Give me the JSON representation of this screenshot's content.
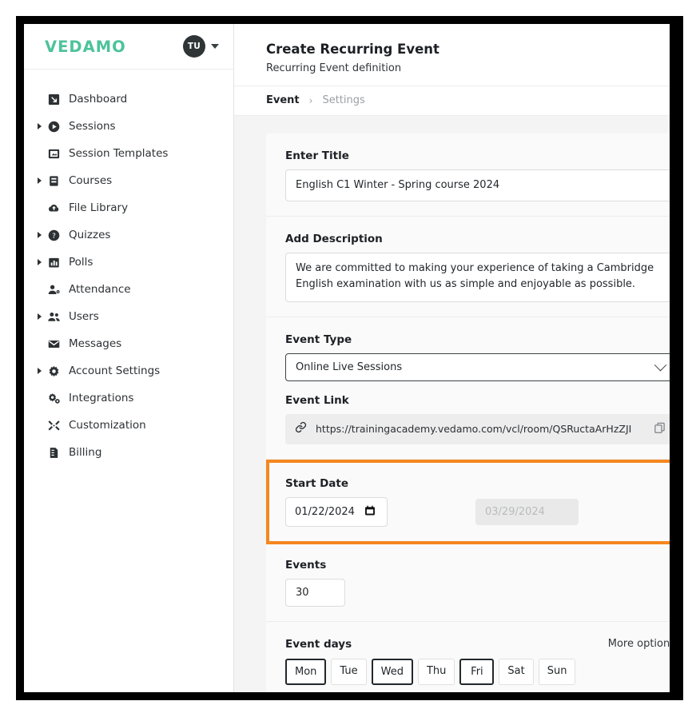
{
  "brand": {
    "logo_text": "VEDAMO",
    "avatar_initials": "TU",
    "caret_icon": "chevron-down-icon"
  },
  "sidebar": {
    "items": [
      {
        "label": "Dashboard",
        "icon": "dashboard-icon",
        "expandable": false
      },
      {
        "label": "Sessions",
        "icon": "play-circle-icon",
        "expandable": true
      },
      {
        "label": "Session Templates",
        "icon": "template-icon",
        "expandable": false
      },
      {
        "label": "Courses",
        "icon": "book-icon",
        "expandable": true
      },
      {
        "label": "File Library",
        "icon": "cloud-upload-icon",
        "expandable": false
      },
      {
        "label": "Quizzes",
        "icon": "question-circle-icon",
        "expandable": true
      },
      {
        "label": "Polls",
        "icon": "bar-chart-icon",
        "expandable": true
      },
      {
        "label": "Attendance",
        "icon": "user-check-icon",
        "expandable": false
      },
      {
        "label": "Users",
        "icon": "users-icon",
        "expandable": true
      },
      {
        "label": "Messages",
        "icon": "envelope-icon",
        "expandable": false
      },
      {
        "label": "Account Settings",
        "icon": "gear-icon",
        "expandable": true
      },
      {
        "label": "Integrations",
        "icon": "gears-icon",
        "expandable": false
      },
      {
        "label": "Customization",
        "icon": "tools-icon",
        "expandable": false
      },
      {
        "label": "Billing",
        "icon": "invoice-icon",
        "expandable": false
      }
    ]
  },
  "header": {
    "title": "Create Recurring Event",
    "subtitle": "Recurring Event definition"
  },
  "breadcrumb": {
    "active": "Event",
    "separator": "›",
    "next": "Settings"
  },
  "form": {
    "title_label": "Enter Title",
    "title_value": "English C1 Winter - Spring course 2024",
    "description_label": "Add Description",
    "description_value": "We are committed to making your experience of taking a Cambridge English examination with us as simple and enjoyable as possible.",
    "event_type_label": "Event Type",
    "event_type_value": "Online Live Sessions",
    "event_link_label": "Event Link",
    "event_link_value": "https://trainingacademy.vedamo.com/vcl/room/QSRuctaArHzZJI",
    "link_icon": "chain-link-icon",
    "copy_icon": "copy-icon",
    "start_date_label": "Start Date",
    "start_date_value": "01/22/2024",
    "end_date_value": "03/29/2024",
    "calendar_icon": "calendar-icon",
    "events_label": "Events",
    "events_value": "30",
    "event_days_label": "Event days",
    "more_options_label": "More options",
    "days": [
      {
        "label": "Mon",
        "selected": true
      },
      {
        "label": "Tue",
        "selected": false
      },
      {
        "label": "Wed",
        "selected": true
      },
      {
        "label": "Thu",
        "selected": false
      },
      {
        "label": "Fri",
        "selected": true
      },
      {
        "label": "Sat",
        "selected": false
      },
      {
        "label": "Sun",
        "selected": false
      }
    ]
  },
  "colors": {
    "brand_teal": "#4cc39b",
    "highlight_orange": "#f5871f",
    "avatar_dark": "#2f3437",
    "content_bg": "#f4f4f4"
  }
}
